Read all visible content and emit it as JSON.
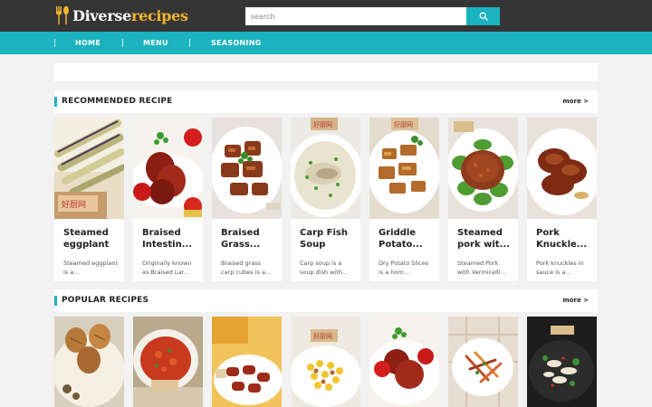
{
  "header": {
    "logo_part1": "Diverse",
    "logo_part2": "recipes",
    "search_placeholder": "search"
  },
  "nav": {
    "items": [
      {
        "label": "HOME"
      },
      {
        "label": "MENU"
      },
      {
        "label": "SEASONING"
      }
    ]
  },
  "recommended": {
    "title": "RECOMMENDED RECIPE",
    "more": "more >",
    "cards": [
      {
        "title": "Steamed eggplant",
        "desc": "Steamed eggplant is a...",
        "image": "steamed-eggplant-photo"
      },
      {
        "title": "Braised Intestin...",
        "desc": "Originally known as Braised Lar...",
        "image": "braised-intestines-photo"
      },
      {
        "title": "Braised Grass...",
        "desc": "Braised grass carp cubes is a...",
        "image": "braised-grass-carp-photo"
      },
      {
        "title": "Carp Fish Soup",
        "desc": "Carp soup is a soup dish with...",
        "image": "carp-fish-soup-photo"
      },
      {
        "title": "Griddle Potato...",
        "desc": "Dry Potato Slices is a hom...",
        "image": "griddle-potato-photo"
      },
      {
        "title": "Steamed pork wit...",
        "desc": "Steamed Pork with Vermicelli...",
        "image": "steamed-pork-photo"
      },
      {
        "title": "Pork Knuckle...",
        "desc": "Pork knuckles in sauce is a...",
        "image": "pork-knuckle-photo"
      }
    ]
  },
  "popular": {
    "title": "POPULAR RECIPES",
    "more": "more >",
    "cards": [
      {
        "image": "tea-eggs-photo"
      },
      {
        "image": "spicy-soup-photo"
      },
      {
        "image": "sausage-photo"
      },
      {
        "image": "corn-peanuts-photo"
      },
      {
        "image": "braised-pork-photo"
      },
      {
        "image": "shredded-salad-photo"
      },
      {
        "image": "mushroom-plate-photo"
      }
    ]
  },
  "colors": {
    "header_bg": "#353535",
    "accent": "#1ab3bf",
    "logo_highlight": "#f2b52e"
  }
}
